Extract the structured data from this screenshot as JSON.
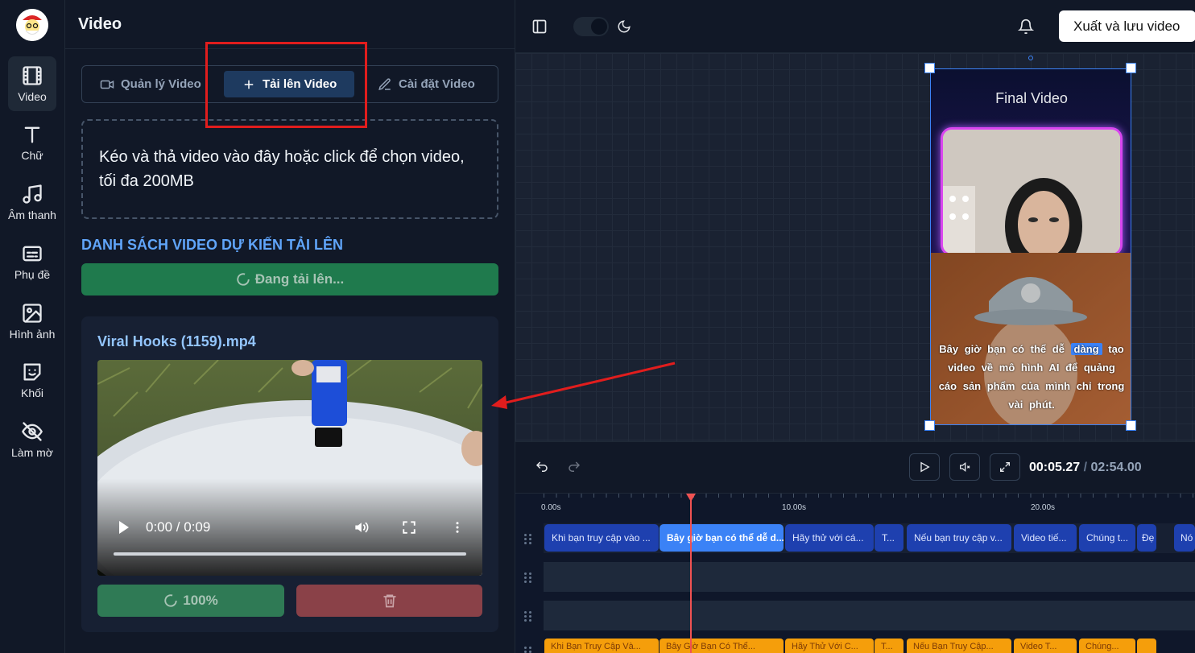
{
  "rail": {
    "items": [
      {
        "label": "Video",
        "icon": "film-icon"
      },
      {
        "label": "Chữ",
        "icon": "text-icon"
      },
      {
        "label": "Âm thanh",
        "icon": "music-icon"
      },
      {
        "label": "Phụ đề",
        "icon": "subtitles-icon"
      },
      {
        "label": "Hình ảnh",
        "icon": "image-icon"
      },
      {
        "label": "Khối",
        "icon": "sticker-icon"
      },
      {
        "label": "Làm mờ",
        "icon": "eye-off-icon"
      }
    ]
  },
  "panel": {
    "title": "Video",
    "tabs": [
      {
        "label": "Quản lý Video"
      },
      {
        "label": "Tải lên Video"
      },
      {
        "label": "Cài đặt Video"
      }
    ],
    "dropzone_text": "Kéo và thả video vào đây hoặc click để chọn video, tối đa 200MB",
    "section_title": "DANH SÁCH VIDEO DỰ KIẾN TẢI LÊN",
    "uploading_label": "Đang tải lên...",
    "file": {
      "name": "Viral Hooks (1159).mp4",
      "player_time": "0:00 / 0:09",
      "progress_label": "100%",
      "progress_value": 100
    }
  },
  "topbar": {
    "export_label": "Xuất và lưu video"
  },
  "preview": {
    "title": "Final Video",
    "subtitle_before": "Bây giờ bạn có thể dễ",
    "subtitle_highlight": "dàng",
    "subtitle_after": "tạo video về mô hình AI để quảng cáo sản phẩm của mình chỉ trong vài phút."
  },
  "controls": {
    "current_time": "00:05.27",
    "separator": "/",
    "total_time": "02:54.00"
  },
  "timeline": {
    "ticks": [
      "0.00s",
      "10.00s",
      "20.00s"
    ],
    "clips": [
      {
        "label": "Khi bạn truy cập vào ...",
        "selected": false
      },
      {
        "label": "Bây giờ bạn có thể dễ d...",
        "selected": true
      },
      {
        "label": "Hãy thử với cá...",
        "selected": false
      },
      {
        "label": "T...",
        "selected": false
      },
      {
        "label": "Nếu bạn truy cập v...",
        "selected": false
      },
      {
        "label": "Video tiế...",
        "selected": false
      },
      {
        "label": "Chúng t...",
        "selected": false
      },
      {
        "label": "Đẹ",
        "selected": false
      },
      {
        "label": "Nó",
        "selected": false
      }
    ],
    "audio_clips": [
      {
        "label": "Khi Bạn Truy Cập Và..."
      },
      {
        "label": "Bây Giờ Bạn Có Thể..."
      },
      {
        "label": "Hãy Thử Với C..."
      },
      {
        "label": "T..."
      },
      {
        "label": "Nếu Bạn Truy Cập..."
      },
      {
        "label": "Video T..."
      },
      {
        "label": "Chúng..."
      }
    ]
  },
  "colors": {
    "accent": "#3b82f6",
    "success": "#1f7a4d",
    "danger": "#8a4148",
    "annotation": "#e11d1d"
  }
}
